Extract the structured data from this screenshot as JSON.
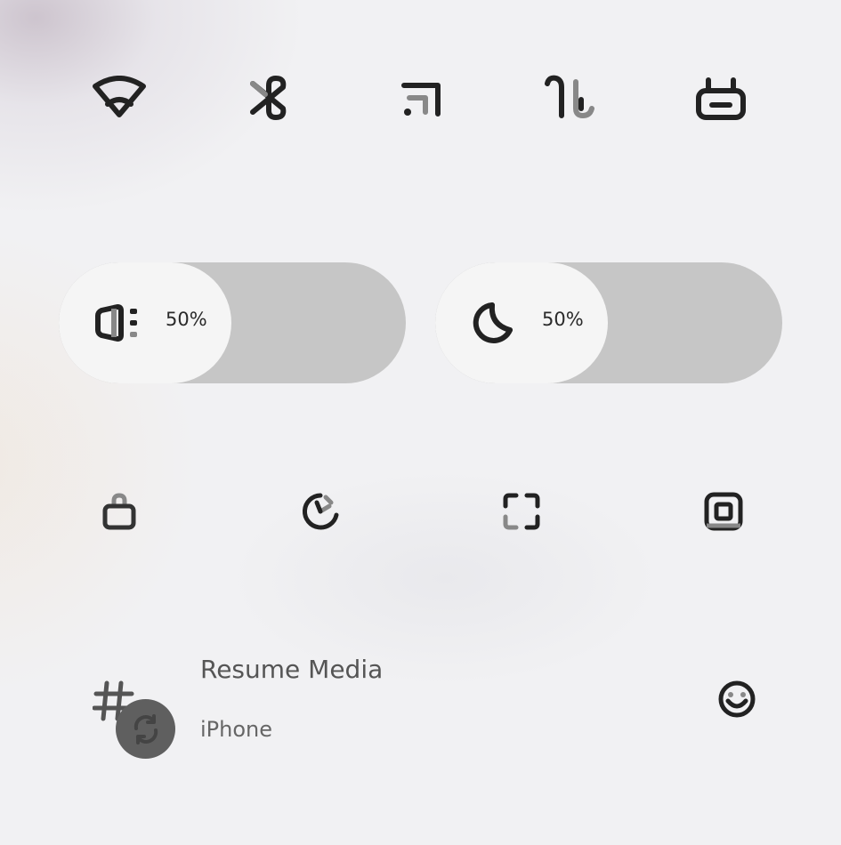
{
  "top_row": [
    {
      "name": "wifi-icon"
    },
    {
      "name": "bluetooth-icon"
    },
    {
      "name": "cellular-icon"
    },
    {
      "name": "data-icon"
    },
    {
      "name": "hotspot-icon"
    }
  ],
  "sliders": {
    "volume": {
      "icon": "speaker-icon",
      "value_label": "50%",
      "level": 0.5
    },
    "brightness": {
      "icon": "moon-icon",
      "value_label": "50%",
      "level": 0.5
    }
  },
  "bottom_row": [
    {
      "name": "lock-icon"
    },
    {
      "name": "timer-icon"
    },
    {
      "name": "screen-mirror-icon"
    },
    {
      "name": "screen-record-icon"
    }
  ],
  "media": {
    "title": "Resume Media",
    "source": "iPhone",
    "app_icon": "hashtag-icon",
    "sync_icon": "sync-icon",
    "action_icon": "smiley-icon"
  }
}
